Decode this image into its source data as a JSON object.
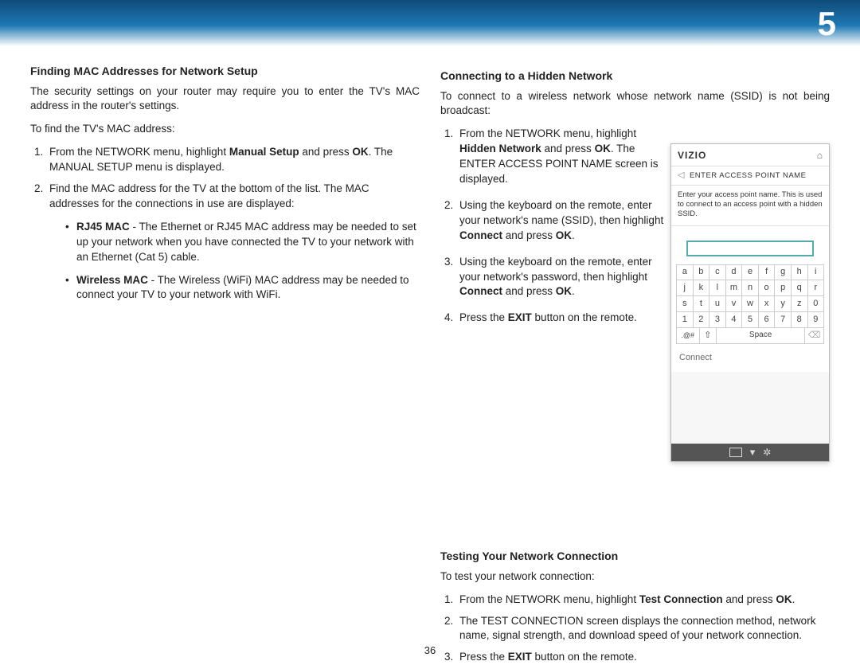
{
  "chapter_number": "5",
  "page_number": "36",
  "left": {
    "heading": "Finding MAC Addresses for Network Setup",
    "intro": "The security settings on your router may require you to enter the TV's MAC address in the router's settings.",
    "lead": "To find the TV's MAC address:",
    "step1_a": "From the NETWORK menu, highlight ",
    "step1_b1": "Manual Setup",
    "step1_b": " and press ",
    "step1_b2": "OK",
    "step1_c": ". The MANUAL SETUP menu is displayed.",
    "step2": "Find the MAC address for the TV at the bottom of the list. The MAC addresses for the connections in use are displayed:",
    "bul1_label": "RJ45 MAC",
    "bul1_text": " - The Ethernet or RJ45 MAC address may be needed to set up your network when you have connected the TV to your network with an Ethernet (Cat 5) cable.",
    "bul2_label": "Wireless MAC",
    "bul2_text": " - The Wireless (WiFi) MAC address may be needed to connect your TV to your network with WiFi."
  },
  "right1": {
    "heading": "Connecting to a Hidden Network",
    "intro": "To connect to a wireless network whose network name (SSID) is not being broadcast:",
    "s1_a": "From the NETWORK menu, highlight ",
    "s1_b1": "Hidden Network",
    "s1_b": " and press ",
    "s1_b2": "OK",
    "s1_c": ". The ENTER ACCESS POINT NAME screen is displayed.",
    "s2_a": "Using the keyboard on the remote, enter your network's name (SSID), then highlight ",
    "s2_b1": "Connect",
    "s2_b": " and press ",
    "s2_b2": "OK",
    "s2_c": ".",
    "s3_a": "Using the keyboard on the remote, enter your network's password, then highlight ",
    "s3_b1": "Connect",
    "s3_b": " and press ",
    "s3_b2": "OK",
    "s3_c": ".",
    "s4_a": "Press the ",
    "s4_b1": "EXIT",
    "s4_b": " button on the remote."
  },
  "right2": {
    "heading": "Testing Your Network Connection",
    "lead": "To test your network connection:",
    "s1_a": "From the NETWORK menu, highlight ",
    "s1_b1": "Test Connection",
    "s1_b": " and press ",
    "s1_b2": "OK",
    "s1_c": ".",
    "s2": "The TEST CONNECTION screen displays the connection method, network name, signal strength, and download speed of your network connection.",
    "s3_a": "Press the ",
    "s3_b1": "EXIT",
    "s3_b": " button on the remote."
  },
  "osd": {
    "brand": "VIZIO",
    "title": "ENTER ACCESS POINT NAME",
    "help": "Enter your access point name. This is used to connect to an access point with a hidden SSID.",
    "connect": "Connect",
    "keys_rows": [
      [
        "a",
        "b",
        "c",
        "d",
        "e",
        "f",
        "g",
        "h",
        "i"
      ],
      [
        "j",
        "k",
        "l",
        "m",
        "n",
        "o",
        "p",
        "q",
        "r"
      ],
      [
        "s",
        "t",
        "u",
        "v",
        "w",
        "x",
        "y",
        "z",
        "0"
      ],
      [
        "1",
        "2",
        "3",
        "4",
        "5",
        "6",
        "7",
        "8",
        "9"
      ]
    ],
    "sym": ".@#",
    "shift": "⇧",
    "space": "Space",
    "del": "⌫"
  }
}
